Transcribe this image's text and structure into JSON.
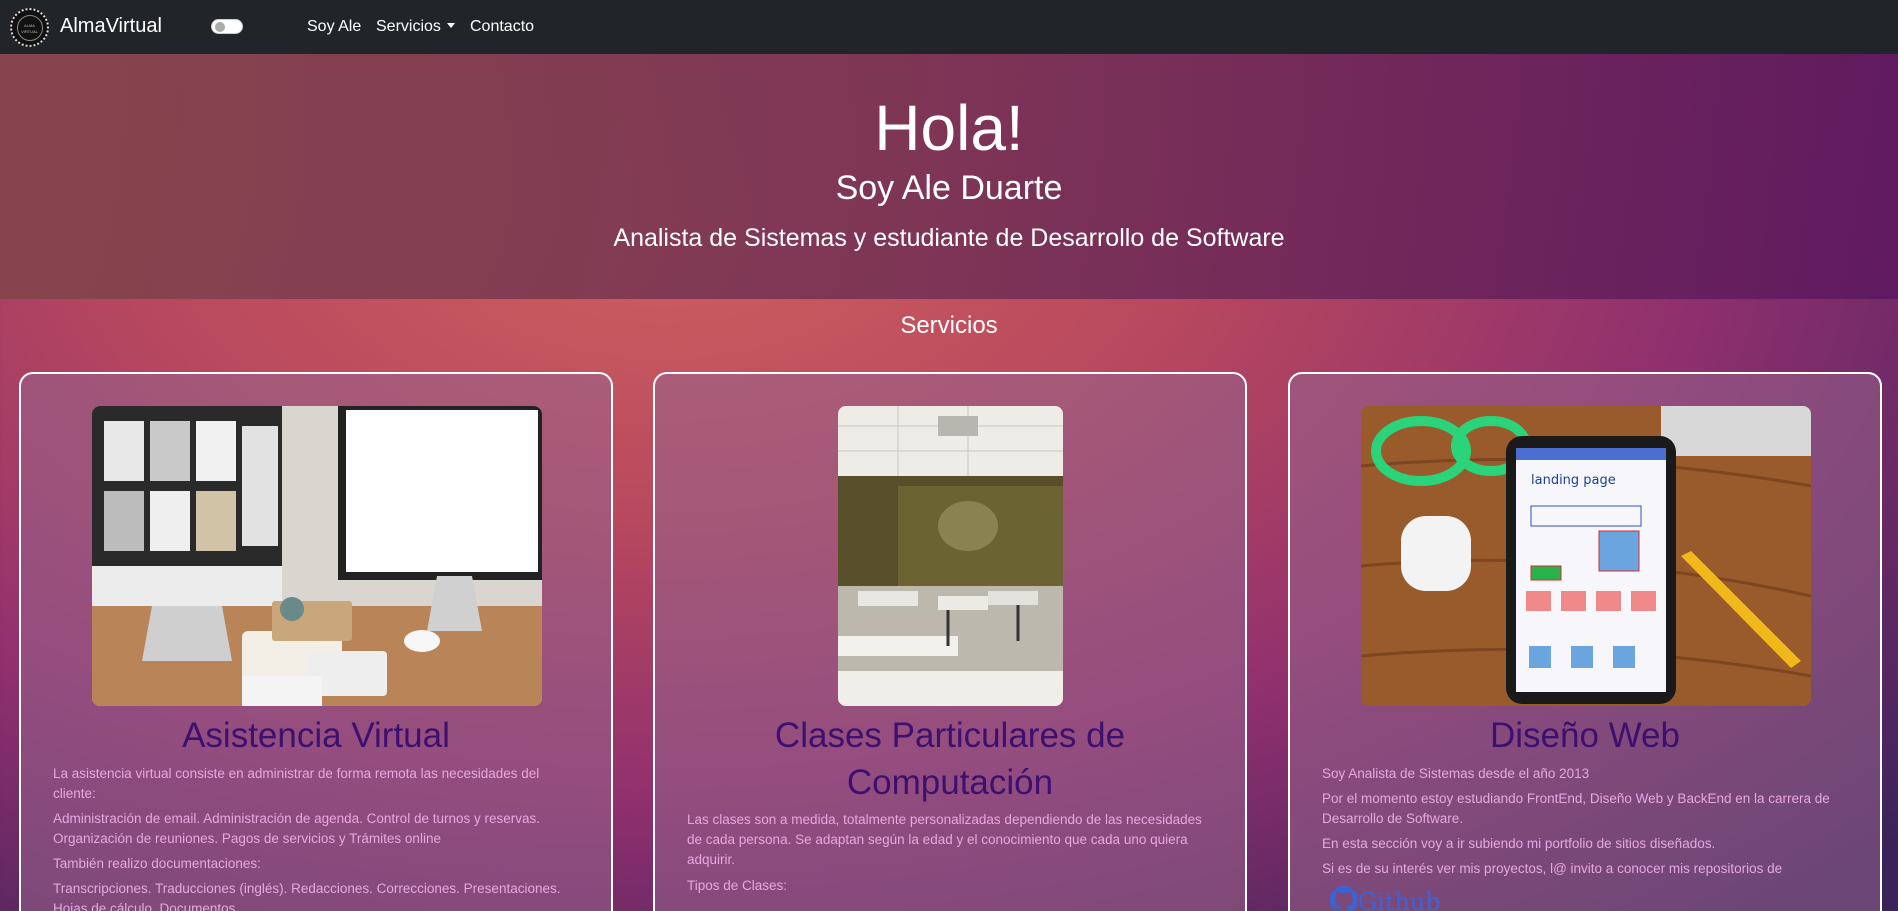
{
  "navbar": {
    "brand": "AlmaVirtual",
    "logo_text": "ALMA VIRTUAL",
    "links": [
      "Soy Ale",
      "Servicios",
      "Contacto"
    ]
  },
  "hero": {
    "greeting": "Hola!",
    "name": "Soy Ale Duarte",
    "role": "Analista de Sistemas y estudiante de Desarrollo de Software"
  },
  "services": {
    "title": "Servicios",
    "cards": [
      {
        "title": "Asistencia Virtual",
        "paragraphs": [
          "La asistencia virtual consiste en administrar de forma remota las necesidades del cliente:",
          "Administración de email. Administración de agenda. Control de turnos y reservas. Organización de reuniones. Pagos de servicios y Trámites online",
          "También realizo documentaciones:",
          "Transcripciones. Traducciones (inglés). Redacciones. Correcciones. Presentaciones. Hojas de cálculo. Documentos."
        ]
      },
      {
        "title": "Clases Particulares de Computación",
        "paragraphs": [
          "Las clases son a medida, totalmente personalizadas dependiendo de las necesidades de cada persona. Se adaptan según la edad y el conocimiento que cada uno quiera adquirir.",
          "Tipos de Clases:"
        ]
      },
      {
        "title": "Diseño Web",
        "paragraphs": [
          "Soy Analista de Sistemas desde el año 2013",
          "Por el momento estoy estudiando FrontEnd, Diseño Web y BackEnd en la carrera de Desarrollo de Software.",
          "En esta sección voy a ir subiendo mi portfolio de sitios diseñados.",
          "Si es de su interés ver mis proyectos, l@ invito a conocer mis repositorios de"
        ],
        "link": "Github"
      }
    ]
  },
  "colors": {
    "navbar_bg": "#212529",
    "card_title": "#3d1070",
    "card_text": "#e6a8e0",
    "github_link": "#3a63d8"
  },
  "icons": [
    "alma-virtual-logo-icon",
    "github-icon",
    "dark-mode-toggle"
  ]
}
